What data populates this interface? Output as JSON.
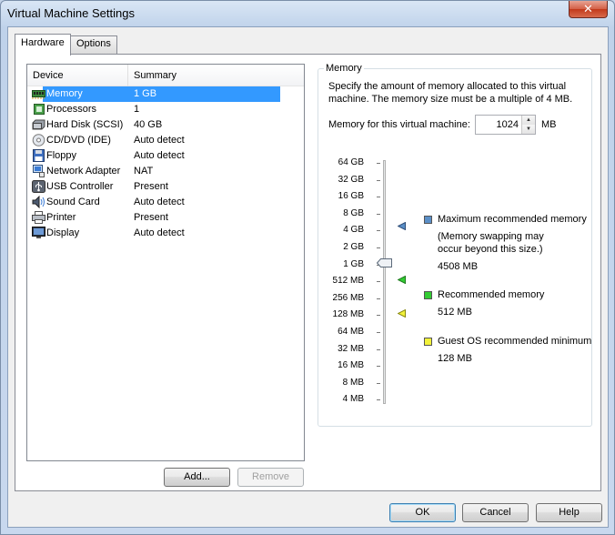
{
  "window": {
    "title": "Virtual Machine Settings",
    "close_glyph": "✕"
  },
  "tabs": [
    {
      "label": "Hardware",
      "active": true
    },
    {
      "label": "Options",
      "active": false
    }
  ],
  "device_list": {
    "headers": {
      "device": "Device",
      "summary": "Summary"
    },
    "rows": [
      {
        "name": "Memory",
        "summary": "1 GB",
        "icon": "memory-icon",
        "selected": true
      },
      {
        "name": "Processors",
        "summary": "1",
        "icon": "processor-icon"
      },
      {
        "name": "Hard Disk (SCSI)",
        "summary": "40 GB",
        "icon": "hard-disk-icon"
      },
      {
        "name": "CD/DVD (IDE)",
        "summary": "Auto detect",
        "icon": "cd-dvd-icon"
      },
      {
        "name": "Floppy",
        "summary": "Auto detect",
        "icon": "floppy-icon"
      },
      {
        "name": "Network Adapter",
        "summary": "NAT",
        "icon": "network-adapter-icon"
      },
      {
        "name": "USB Controller",
        "summary": "Present",
        "icon": "usb-icon"
      },
      {
        "name": "Sound Card",
        "summary": "Auto detect",
        "icon": "sound-card-icon"
      },
      {
        "name": "Printer",
        "summary": "Present",
        "icon": "printer-icon"
      },
      {
        "name": "Display",
        "summary": "Auto detect",
        "icon": "display-icon"
      }
    ]
  },
  "list_buttons": {
    "add": "Add...",
    "remove": "Remove"
  },
  "memory": {
    "group_title": "Memory",
    "description": "Specify the amount of memory allocated to this virtual machine. The memory size must be a multiple of 4 MB.",
    "field_label": "Memory for this virtual machine:",
    "field_value": "1024",
    "unit": "MB",
    "scale": [
      "64 GB",
      "32 GB",
      "16 GB",
      "8 GB",
      "4 GB",
      "2 GB",
      "1 GB",
      "512 MB",
      "256 MB",
      "128 MB",
      "64 MB",
      "32 MB",
      "16 MB",
      "8 MB",
      "4 MB"
    ],
    "current": "1 GB",
    "legend": {
      "max_title": "Maximum recommended memory",
      "max_note": "(Memory swapping may occur beyond this size.)",
      "max_value": "4508 MB",
      "rec_title": "Recommended memory",
      "rec_value": "512 MB",
      "min_title": "Guest OS recommended minimum",
      "min_value": "128 MB"
    },
    "colors": {
      "max": "#5b8fc7",
      "rec": "#33cc33",
      "min": "#f2f23a"
    }
  },
  "dialog_buttons": {
    "ok": "OK",
    "cancel": "Cancel",
    "help": "Help"
  }
}
